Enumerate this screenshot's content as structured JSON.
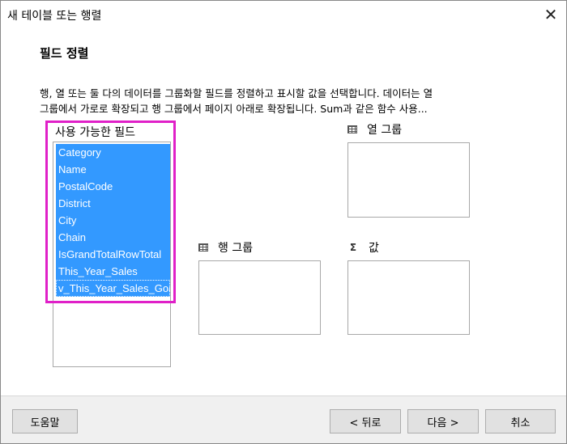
{
  "window": {
    "title": "새 테이블 또는 행렬",
    "close_glyph": "✕"
  },
  "page": {
    "heading": "필드 정렬",
    "description_line1": "행, 열 또는 둘 다의 데이터를 그룹화할 필드를 정렬하고 표시할 값을 선택합니다. 데이터는 열",
    "description_line2": "그룹에서 가로로 확장되고 행 그룹에서 페이지 아래로 확장됩니다.  Sum과 같은 함수 사용..."
  },
  "available_fields": {
    "label": "사용 가능한 필드",
    "items": [
      "Category",
      "Name",
      "PostalCode",
      "District",
      "City",
      "Chain",
      "IsGrandTotalRowTotal",
      "This_Year_Sales",
      "v_This_Year_Sales_Goal"
    ],
    "selection_color": "#3399ff",
    "highlight_color": "#e020c8"
  },
  "zones": {
    "column_groups": {
      "label": "열 그룹",
      "icon": "table-icon"
    },
    "row_groups": {
      "label": "행 그룹",
      "icon": "table-icon"
    },
    "values": {
      "label": "값",
      "icon": "sigma-icon",
      "icon_glyph": "Σ"
    }
  },
  "buttons": {
    "help": "도움말",
    "back": "< 뒤로",
    "next": "다음 >",
    "cancel": "취소"
  }
}
